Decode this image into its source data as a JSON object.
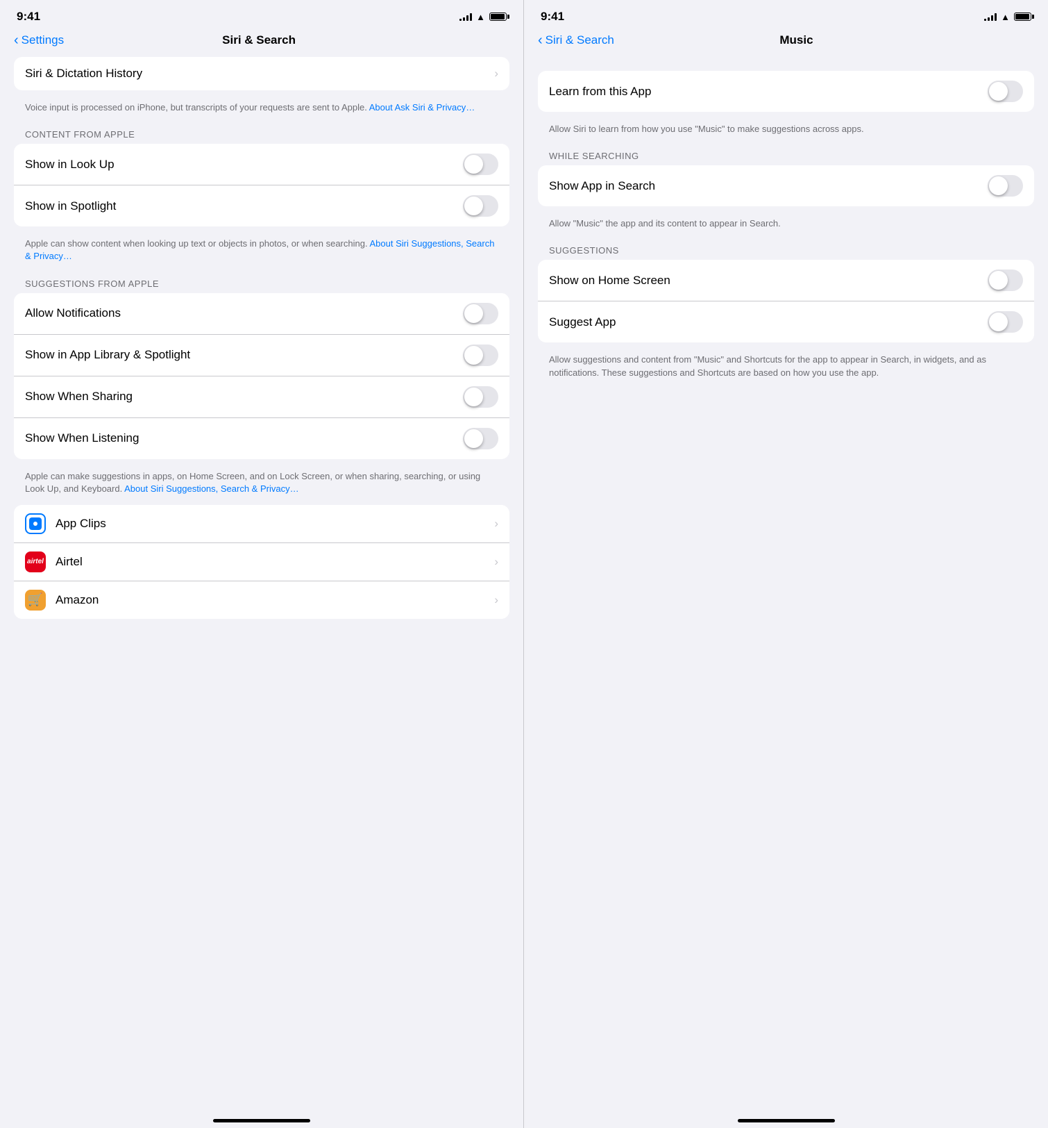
{
  "left_panel": {
    "status": {
      "time": "9:41"
    },
    "nav": {
      "back_label": "Settings",
      "title": "Siri & Search"
    },
    "siri_dictation": {
      "label": "Siri & Dictation History",
      "description": "Voice input is processed on iPhone, but transcripts of your requests are sent to Apple.",
      "link_text": "About Ask Siri & Privacy…"
    },
    "content_from_apple": {
      "section_label": "CONTENT FROM APPLE",
      "show_look_up": "Show in Look Up",
      "show_spotlight": "Show in Spotlight",
      "description": "Apple can show content when looking up text or objects in photos, or when searching.",
      "link_text": "About Siri Suggestions, Search & Privacy…"
    },
    "suggestions_from_apple": {
      "section_label": "SUGGESTIONS FROM APPLE",
      "allow_notifications": "Allow Notifications",
      "show_app_library": "Show in App Library & Spotlight",
      "show_when_sharing": "Show When Sharing",
      "show_when_listening": "Show When Listening",
      "description": "Apple can make suggestions in apps, on Home Screen, and on Lock Screen, or when sharing, searching, or using Look Up, and Keyboard.",
      "link_text": "About Siri Suggestions, Search & Privacy…"
    },
    "apps": {
      "app_clips": {
        "label": "App Clips"
      },
      "airtel": {
        "label": "Airtel"
      },
      "amazon": {
        "label": "Amazon"
      }
    }
  },
  "right_panel": {
    "status": {
      "time": "9:41"
    },
    "nav": {
      "back_label": "Siri & Search",
      "title": "Music"
    },
    "learn_section": {
      "label": "Learn from this App",
      "description": "Allow Siri to learn from how you use \"Music\" to make suggestions across apps."
    },
    "while_searching": {
      "section_label": "WHILE SEARCHING",
      "show_app_in_search": "Show App in Search",
      "description": "Allow \"Music\" the app and its content to appear in Search."
    },
    "suggestions": {
      "section_label": "SUGGESTIONS",
      "show_home_screen": "Show on Home Screen",
      "suggest_app": "Suggest App",
      "description": "Allow suggestions and content from \"Music\" and Shortcuts for the app to appear in Search, in widgets, and as notifications. These suggestions and Shortcuts are based on how you use the app."
    }
  }
}
